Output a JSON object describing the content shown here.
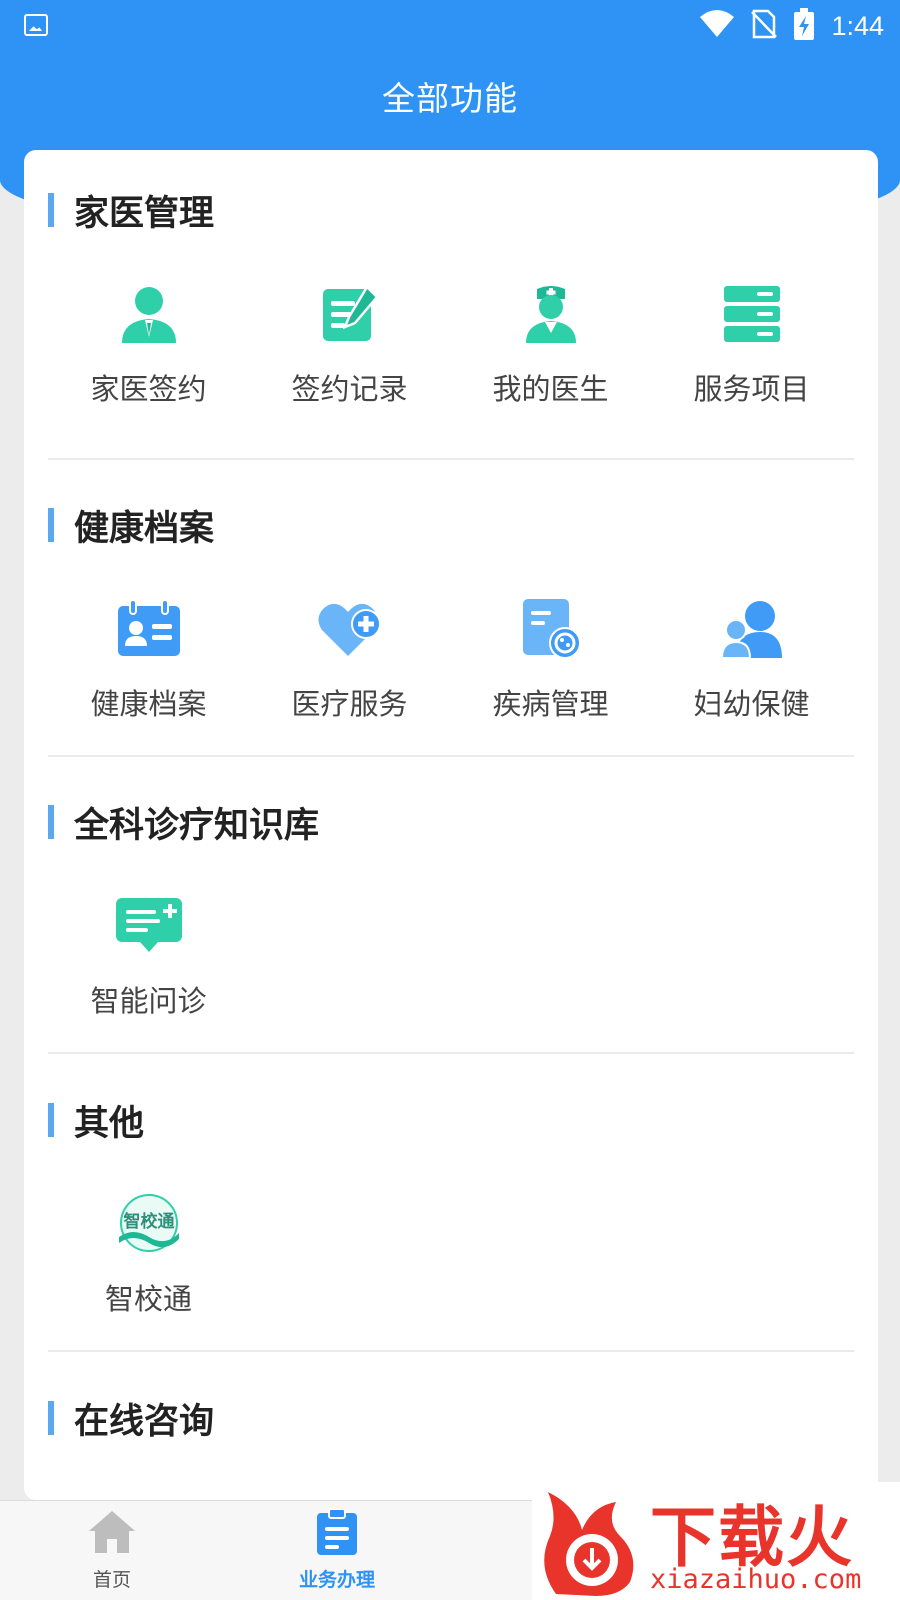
{
  "status_bar": {
    "time": "1:44"
  },
  "header": {
    "title": "全部功能"
  },
  "sections": [
    {
      "title": "家医管理",
      "items": [
        {
          "label": "家医签约",
          "icon": "user-suit-icon"
        },
        {
          "label": "签约记录",
          "icon": "edit-document-icon"
        },
        {
          "label": "我的医生",
          "icon": "nurse-icon"
        },
        {
          "label": "服务项目",
          "icon": "server-stack-icon"
        }
      ]
    },
    {
      "title": "健康档案",
      "items": [
        {
          "label": "健康档案",
          "icon": "id-card-icon"
        },
        {
          "label": "医疗服务",
          "icon": "heart-plus-icon"
        },
        {
          "label": "疾病管理",
          "icon": "document-virus-icon"
        },
        {
          "label": "妇幼保健",
          "icon": "mother-child-icon"
        }
      ]
    },
    {
      "title": "全科诊疗知识库",
      "items": [
        {
          "label": "智能问诊",
          "icon": "chat-plus-icon"
        }
      ]
    },
    {
      "title": "其他",
      "items": [
        {
          "label": "智校通",
          "icon": "zhixiaotong-logo-icon",
          "logo_text": "智校通"
        }
      ]
    },
    {
      "title": "在线咨询",
      "items": []
    }
  ],
  "tabbar": {
    "tabs": [
      {
        "label": "首页",
        "icon": "home-icon",
        "active": false
      },
      {
        "label": "业务办理",
        "icon": "clipboard-icon",
        "active": true
      }
    ]
  },
  "watermark": {
    "text": "下载火",
    "url": "xiazaihuo.com"
  },
  "colors": {
    "primary": "#2e93f5",
    "teal": "#2fcfa9",
    "blue_icon": "#3f9bf5",
    "section_accent": "#5aa8f0"
  }
}
